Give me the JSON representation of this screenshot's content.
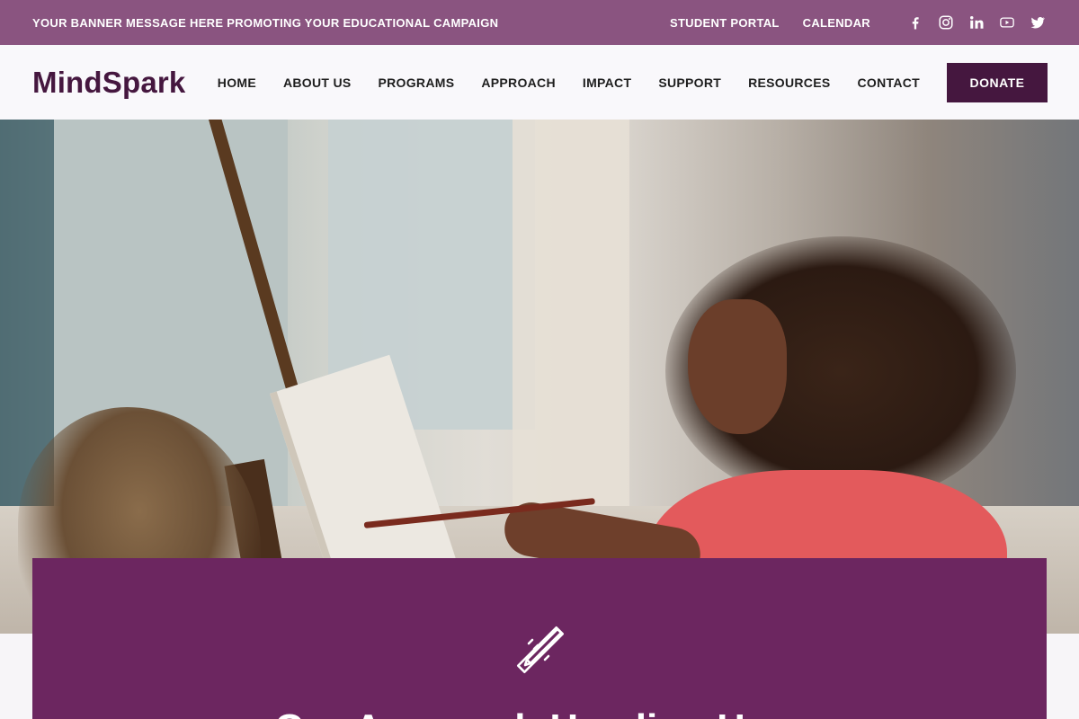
{
  "topbar": {
    "banner": "YOUR BANNER MESSAGE HERE PROMOTING YOUR EDUCATIONAL CAMPAIGN",
    "links": [
      {
        "label": "STUDENT PORTAL"
      },
      {
        "label": "CALENDAR"
      }
    ],
    "socials": [
      {
        "icon": "facebook-icon"
      },
      {
        "icon": "instagram-icon"
      },
      {
        "icon": "linkedin-icon"
      },
      {
        "icon": "youtube-icon"
      },
      {
        "icon": "twitter-icon"
      }
    ]
  },
  "header": {
    "logo": "MindSpark",
    "nav": [
      {
        "label": "HOME"
      },
      {
        "label": "ABOUT US"
      },
      {
        "label": "PROGRAMS"
      },
      {
        "label": "APPROACH"
      },
      {
        "label": "IMPACT"
      },
      {
        "label": "SUPPORT"
      },
      {
        "label": "RESOURCES"
      },
      {
        "label": "CONTACT"
      }
    ],
    "donate_label": "DONATE"
  },
  "hero": {
    "image": "child-painting-at-easel-photo"
  },
  "card": {
    "icon": "pencil-ruler-icon",
    "heading": "Our Approach Heading Here"
  },
  "colors": {
    "banner": "#8a5480",
    "brand": "#45173f",
    "card": "#6c2660"
  }
}
